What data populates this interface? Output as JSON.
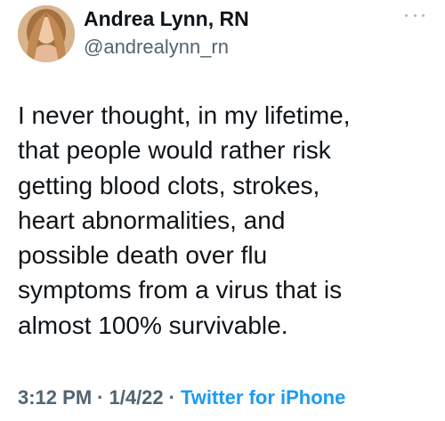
{
  "tweet": {
    "author": {
      "display_name": "Andrea Lynn, RN",
      "handle": "@andrealynn_rn",
      "avatar": "avatar-photo"
    },
    "more_icon": "more-horizontal-icon",
    "text_lines": [
      "I never thought, in my lifetime,",
      "that people would rather risk",
      "getting blood clots, strokes,",
      "heart abnormalities, and",
      "possible death over flu",
      "symptoms from a virus that is",
      "almost 100% survivable."
    ],
    "meta": {
      "time": "3:12 PM",
      "separator": "·",
      "date": "1/4/22",
      "source": "Twitter for iPhone"
    },
    "colors": {
      "text": "#0f1419",
      "secondary": "#536471",
      "link": "#1d9bf0"
    }
  }
}
